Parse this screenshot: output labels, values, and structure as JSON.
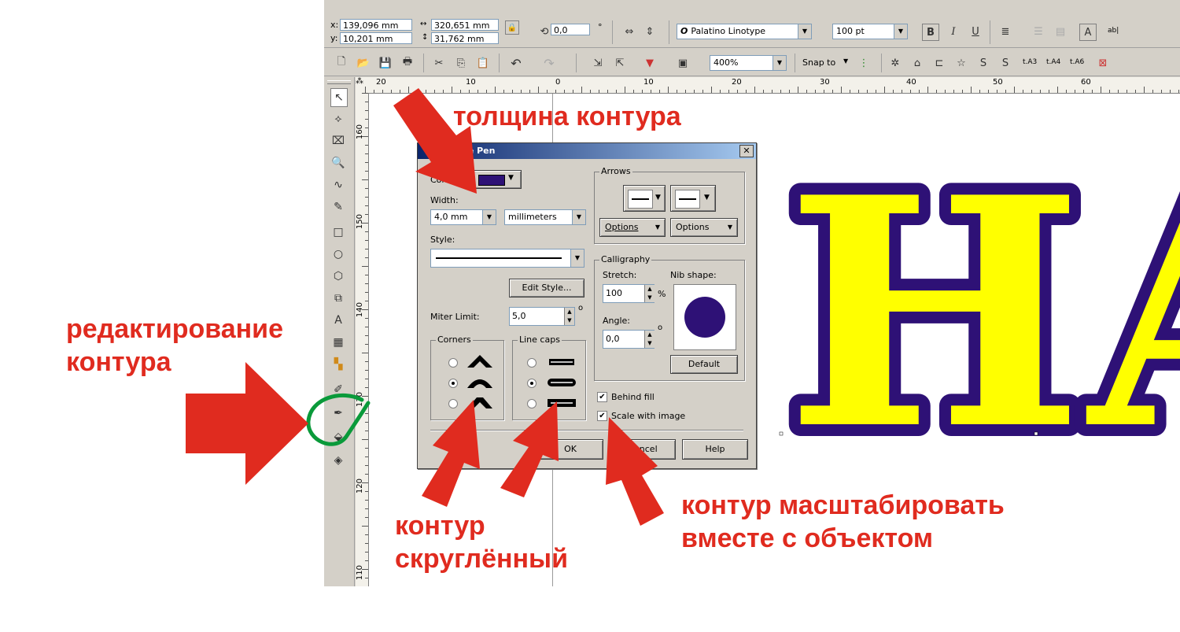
{
  "propbar": {
    "x_label": "x:",
    "x_value": "139,096 mm",
    "y_label": "y:",
    "y_value": "10,201 mm",
    "w_value": "320,651 mm",
    "h_value": "31,762 mm",
    "angle_value": "0,0",
    "angle_unit": "°",
    "font_name": "Palatino Linotype",
    "font_size": "100 pt",
    "bold_label": "B",
    "italic_label": "I",
    "underline_label": "U",
    "text_tool_label": "ab|"
  },
  "stdbar": {
    "zoom": "400%",
    "snap_label": "Snap to",
    "label_a3": "t.A3",
    "label_a4": "t.A4",
    "label_a6": "t.A6"
  },
  "hruler": {
    "ticks": [
      "20",
      "10",
      "0",
      "10",
      "20",
      "30",
      "40",
      "50",
      "60"
    ]
  },
  "vruler": {
    "ticks": [
      "160",
      "150",
      "140",
      "130",
      "120",
      "110"
    ]
  },
  "dialog": {
    "title": "Outline Pen",
    "color_label": "Color:",
    "color_value": "#2e1176",
    "width_label": "Width:",
    "width_value": "4,0 mm",
    "unit_value": "millimeters",
    "style_label": "Style:",
    "edit_style_button": "Edit Style...",
    "miter_label": "Miter Limit:",
    "miter_value": "5,0",
    "miter_unit": "o",
    "corners_label": "Corners",
    "line_caps_label": "Line caps",
    "arrows_label": "Arrows",
    "options_left": "Options",
    "options_right": "Options",
    "calligraphy_label": "Calligraphy",
    "stretch_label": "Stretch:",
    "stretch_value": "100",
    "stretch_unit": "%",
    "nib_label": "Nib shape:",
    "angle_label": "Angle:",
    "angle_value": "0,0",
    "angle_unit": "o",
    "default_button": "Default",
    "behind_fill_label": "Behind fill",
    "scale_with_image_label": "Scale with image",
    "ok_button": "OK",
    "cancel_button": "Cancel",
    "help_button": "Help"
  },
  "canvas": {
    "text": "НА",
    "fill_color": "#ffff00",
    "outline_color": "#2e1176"
  },
  "annotations": {
    "thickness": "толщина контура",
    "edit_outline_line1": "редактирование",
    "edit_outline_line2": "контура",
    "rounded_line1": "контур",
    "rounded_line2": "скруглённый",
    "scale_line1": "контур масштабировать",
    "scale_line2": "вместе с объектом"
  },
  "colors": {
    "arrow_red": "#e02b1f",
    "circle_green": "#0a9a3a",
    "highlight_outline": "#2e1176"
  }
}
